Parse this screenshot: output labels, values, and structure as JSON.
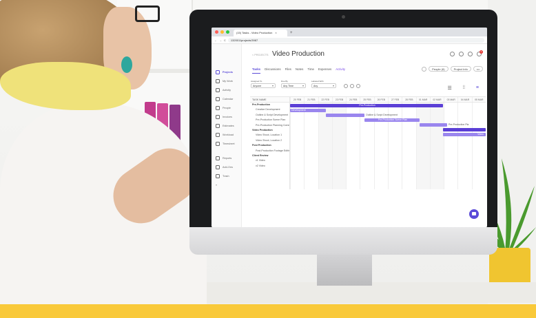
{
  "browser": {
    "tab_title": "(15) Tasks - Video Production",
    "tab_close": "×",
    "new_tab": "+",
    "url": "1320011projects/3987",
    "nav": [
      "←",
      "→",
      "C"
    ]
  },
  "sidebar": {
    "items": [
      {
        "label": "Projects",
        "active": true
      },
      {
        "label": "My Work"
      },
      {
        "label": "Activity"
      },
      {
        "label": "Calendar"
      },
      {
        "label": "People"
      },
      {
        "label": "Invoices"
      },
      {
        "label": "Estimates"
      },
      {
        "label": "Workload"
      },
      {
        "label": "Timesheet"
      }
    ],
    "items_bottom": [
      {
        "label": "Reports"
      },
      {
        "label": "Add-Ons"
      },
      {
        "label": "Trash"
      }
    ],
    "collapse": "«"
  },
  "header": {
    "breadcrumb": "< PROJECTS",
    "title": "Video Production",
    "notification_count": "3"
  },
  "tabs": [
    "Tasks",
    "Discussions",
    "Files",
    "Notes",
    "Time",
    "Expenses",
    "Activity"
  ],
  "actions": {
    "people": "People (6)",
    "project_info": "Project Info",
    "more": "•••"
  },
  "filters": [
    {
      "label": "Assigned To",
      "value": "Anyone"
    },
    {
      "label": "Due By",
      "value": "Any Time"
    },
    {
      "label": "Labeled With",
      "value": "Any"
    }
  ],
  "gantt": {
    "name_header": "TASK NAME",
    "dates": [
      "20 FEB",
      "21 FEB",
      "22 FEB",
      "23 FEB",
      "24 FEB",
      "25 FEB",
      "26 FEB",
      "27 FEB",
      "28 FEB",
      "01 MAR",
      "02 MAR",
      "03 MAR",
      "04 MAR",
      "05 MAR"
    ],
    "rows": [
      {
        "label": "Pre-Production",
        "type": "grp"
      },
      {
        "label": "Creative Development",
        "type": "sub"
      },
      {
        "label": "Outline & Script Development",
        "type": "sub"
      },
      {
        "label": "Pre-Production Scene Plan",
        "type": "sub"
      },
      {
        "label": "Pre-Production Planning Comm...",
        "type": "sub"
      },
      {
        "label": "Video Production",
        "type": "grp"
      },
      {
        "label": "Video Shoot, Location 1",
        "type": "sub"
      },
      {
        "label": "Video Shoot, Location 2",
        "type": "sub"
      },
      {
        "label": "Post Production",
        "type": "grp"
      },
      {
        "label": "Post-Production Footage Editing",
        "type": "sub"
      },
      {
        "label": "Client Review",
        "type": "grp"
      },
      {
        "label": "v1 Video",
        "type": "sub"
      },
      {
        "label": "v2 Video",
        "type": "sub"
      }
    ],
    "bar_labels": {
      "pre_production": "Pre-Production",
      "creative": "Development",
      "outline": "Outline & Script Development",
      "scene_plan": "Pre-Production Scene Plan",
      "pre_production_2": "Pre-Production Pla",
      "v2": "Video"
    }
  },
  "colors": {
    "accent": "#5b4bd8",
    "bar_dark": "#5b3fd6",
    "bar_light": "#9a86ee",
    "banner": "#f9c93a"
  },
  "icons": [
    "search-icon",
    "clock-icon",
    "bell-icon",
    "help-icon",
    "chat-icon",
    "list-view-icon",
    "board-view-icon",
    "gantt-view-icon"
  ]
}
